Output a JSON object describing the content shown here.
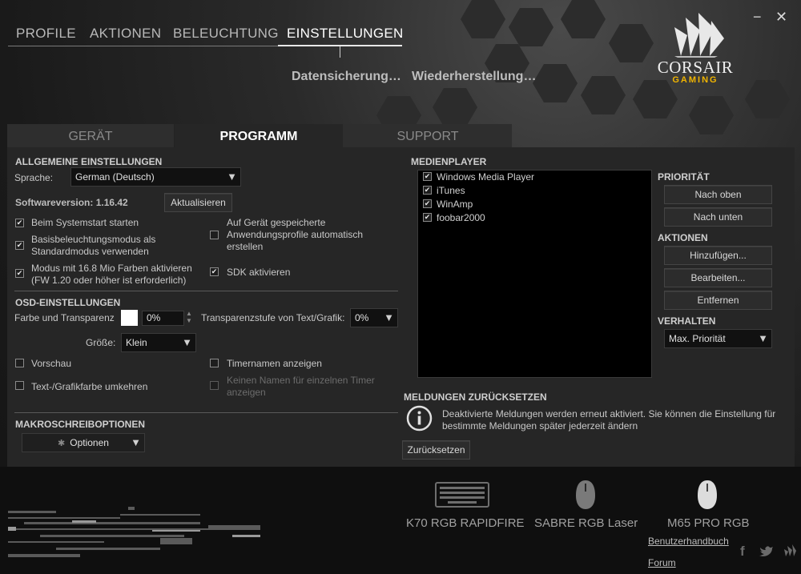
{
  "window": {
    "minimize_label": "−",
    "close_label": "✕"
  },
  "top_nav": {
    "items": [
      "PROFILE",
      "AKTIONEN",
      "BELEUCHTUNG",
      "EINSTELLUNGEN"
    ],
    "active": "EINSTELLUNGEN"
  },
  "sub_actions": {
    "backup": "Datensicherung…",
    "restore": "Wiederherstellung…"
  },
  "logo": {
    "brand": "CORSAIR",
    "sub": "GAMING",
    "icon": "corsair-sails-icon",
    "accent": "#f0b400"
  },
  "panel_tabs": [
    "GERÄT",
    "PROGRAMM",
    "SUPPORT"
  ],
  "general": {
    "title": "ALLGEMEINE EINSTELLUNGEN",
    "language_label": "Sprache:",
    "language_value": "German (Deutsch)",
    "version_label": "Softwareversion: 1.16.42",
    "update_button": "Aktualisieren",
    "checkboxes": {
      "autostart": {
        "label": "Beim Systemstart starten",
        "checked": true
      },
      "base_lighting": {
        "label": "Basisbeleuchtungsmodus als Standardmodus verwenden",
        "checked": true
      },
      "color_mode": {
        "label": "Modus mit 16.8 Mio Farben aktivieren (FW 1.20 oder höher ist erforderlich)",
        "checked": true
      },
      "auto_profiles": {
        "label": "Auf Gerät gespeicherte Anwendungsprofile automatisch erstellen",
        "checked": false
      },
      "sdk": {
        "label": "SDK aktivieren",
        "checked": true
      }
    }
  },
  "osd": {
    "title": "OSD-EINSTELLUNGEN",
    "color_label": "Farbe und Transparenz",
    "transparency_value": "0%",
    "text_transparency_label": "Transparenzstufe von Text/Grafik:",
    "text_transparency_value": "0%",
    "size_label": "Größe:",
    "size_value": "Klein",
    "preview": {
      "label": "Vorschau",
      "checked": false
    },
    "timer_names": {
      "label": "Timernamen anzeigen",
      "checked": false
    },
    "invert": {
      "label": "Text-/Grafikfarbe umkehren",
      "checked": false
    },
    "no_single_names": {
      "label": "Keinen Namen für einzelnen Timer anzeigen",
      "checked": false,
      "disabled": true
    }
  },
  "macro": {
    "title": "MAKROSCHREIBOPTIONEN",
    "options_button": "Optionen"
  },
  "media": {
    "title": "MEDIENPLAYER",
    "players": [
      {
        "name": "Windows Media Player",
        "checked": true
      },
      {
        "name": "iTunes",
        "checked": true
      },
      {
        "name": "WinAmp",
        "checked": true
      },
      {
        "name": "foobar2000",
        "checked": true
      }
    ],
    "priority_title": "PRIORITÄT",
    "up_button": "Nach oben",
    "down_button": "Nach unten",
    "actions_title": "AKTIONEN",
    "add_button": "Hinzufügen...",
    "edit_button": "Bearbeiten...",
    "remove_button": "Entfernen",
    "behavior_title": "VERHALTEN",
    "behavior_value": "Max. Priorität"
  },
  "reset": {
    "title": "MELDUNGEN ZURÜCKSETZEN",
    "text": "Deaktivierte Meldungen werden erneut aktiviert. Sie können die Einstellung für bestimmte Meldungen später jederzeit ändern",
    "button": "Zurücksetzen"
  },
  "devices": [
    {
      "name": "K70 RGB RAPIDFIRE",
      "icon": "keyboard-icon"
    },
    {
      "name": "SABRE RGB Laser",
      "icon": "mouse-icon"
    },
    {
      "name": "M65 PRO RGB",
      "icon": "mouse-icon"
    }
  ],
  "footer": {
    "manual": "Benutzerhandbuch",
    "forum": "Forum",
    "social": [
      "facebook-icon",
      "twitter-icon",
      "corsair-icon"
    ]
  }
}
